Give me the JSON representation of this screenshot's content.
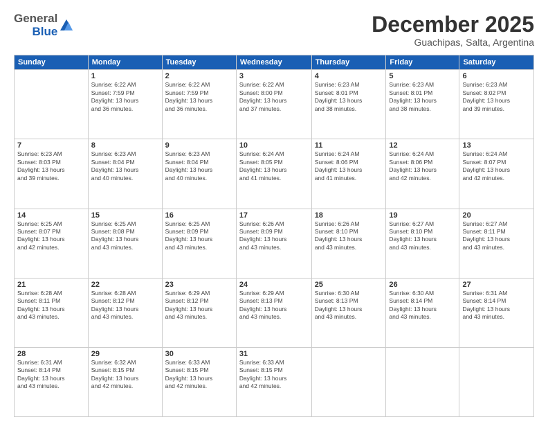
{
  "header": {
    "logo_general": "General",
    "logo_blue": "Blue",
    "month": "December 2025",
    "location": "Guachipas, Salta, Argentina"
  },
  "days_of_week": [
    "Sunday",
    "Monday",
    "Tuesday",
    "Wednesday",
    "Thursday",
    "Friday",
    "Saturday"
  ],
  "weeks": [
    [
      {
        "day": "",
        "info": ""
      },
      {
        "day": "1",
        "info": "Sunrise: 6:22 AM\nSunset: 7:59 PM\nDaylight: 13 hours\nand 36 minutes."
      },
      {
        "day": "2",
        "info": "Sunrise: 6:22 AM\nSunset: 7:59 PM\nDaylight: 13 hours\nand 36 minutes."
      },
      {
        "day": "3",
        "info": "Sunrise: 6:22 AM\nSunset: 8:00 PM\nDaylight: 13 hours\nand 37 minutes."
      },
      {
        "day": "4",
        "info": "Sunrise: 6:23 AM\nSunset: 8:01 PM\nDaylight: 13 hours\nand 38 minutes."
      },
      {
        "day": "5",
        "info": "Sunrise: 6:23 AM\nSunset: 8:01 PM\nDaylight: 13 hours\nand 38 minutes."
      },
      {
        "day": "6",
        "info": "Sunrise: 6:23 AM\nSunset: 8:02 PM\nDaylight: 13 hours\nand 39 minutes."
      }
    ],
    [
      {
        "day": "7",
        "info": "Sunrise: 6:23 AM\nSunset: 8:03 PM\nDaylight: 13 hours\nand 39 minutes."
      },
      {
        "day": "8",
        "info": "Sunrise: 6:23 AM\nSunset: 8:04 PM\nDaylight: 13 hours\nand 40 minutes."
      },
      {
        "day": "9",
        "info": "Sunrise: 6:23 AM\nSunset: 8:04 PM\nDaylight: 13 hours\nand 40 minutes."
      },
      {
        "day": "10",
        "info": "Sunrise: 6:24 AM\nSunset: 8:05 PM\nDaylight: 13 hours\nand 41 minutes."
      },
      {
        "day": "11",
        "info": "Sunrise: 6:24 AM\nSunset: 8:06 PM\nDaylight: 13 hours\nand 41 minutes."
      },
      {
        "day": "12",
        "info": "Sunrise: 6:24 AM\nSunset: 8:06 PM\nDaylight: 13 hours\nand 42 minutes."
      },
      {
        "day": "13",
        "info": "Sunrise: 6:24 AM\nSunset: 8:07 PM\nDaylight: 13 hours\nand 42 minutes."
      }
    ],
    [
      {
        "day": "14",
        "info": "Sunrise: 6:25 AM\nSunset: 8:07 PM\nDaylight: 13 hours\nand 42 minutes."
      },
      {
        "day": "15",
        "info": "Sunrise: 6:25 AM\nSunset: 8:08 PM\nDaylight: 13 hours\nand 43 minutes."
      },
      {
        "day": "16",
        "info": "Sunrise: 6:25 AM\nSunset: 8:09 PM\nDaylight: 13 hours\nand 43 minutes."
      },
      {
        "day": "17",
        "info": "Sunrise: 6:26 AM\nSunset: 8:09 PM\nDaylight: 13 hours\nand 43 minutes."
      },
      {
        "day": "18",
        "info": "Sunrise: 6:26 AM\nSunset: 8:10 PM\nDaylight: 13 hours\nand 43 minutes."
      },
      {
        "day": "19",
        "info": "Sunrise: 6:27 AM\nSunset: 8:10 PM\nDaylight: 13 hours\nand 43 minutes."
      },
      {
        "day": "20",
        "info": "Sunrise: 6:27 AM\nSunset: 8:11 PM\nDaylight: 13 hours\nand 43 minutes."
      }
    ],
    [
      {
        "day": "21",
        "info": "Sunrise: 6:28 AM\nSunset: 8:11 PM\nDaylight: 13 hours\nand 43 minutes."
      },
      {
        "day": "22",
        "info": "Sunrise: 6:28 AM\nSunset: 8:12 PM\nDaylight: 13 hours\nand 43 minutes."
      },
      {
        "day": "23",
        "info": "Sunrise: 6:29 AM\nSunset: 8:12 PM\nDaylight: 13 hours\nand 43 minutes."
      },
      {
        "day": "24",
        "info": "Sunrise: 6:29 AM\nSunset: 8:13 PM\nDaylight: 13 hours\nand 43 minutes."
      },
      {
        "day": "25",
        "info": "Sunrise: 6:30 AM\nSunset: 8:13 PM\nDaylight: 13 hours\nand 43 minutes."
      },
      {
        "day": "26",
        "info": "Sunrise: 6:30 AM\nSunset: 8:14 PM\nDaylight: 13 hours\nand 43 minutes."
      },
      {
        "day": "27",
        "info": "Sunrise: 6:31 AM\nSunset: 8:14 PM\nDaylight: 13 hours\nand 43 minutes."
      }
    ],
    [
      {
        "day": "28",
        "info": "Sunrise: 6:31 AM\nSunset: 8:14 PM\nDaylight: 13 hours\nand 43 minutes."
      },
      {
        "day": "29",
        "info": "Sunrise: 6:32 AM\nSunset: 8:15 PM\nDaylight: 13 hours\nand 42 minutes."
      },
      {
        "day": "30",
        "info": "Sunrise: 6:33 AM\nSunset: 8:15 PM\nDaylight: 13 hours\nand 42 minutes."
      },
      {
        "day": "31",
        "info": "Sunrise: 6:33 AM\nSunset: 8:15 PM\nDaylight: 13 hours\nand 42 minutes."
      },
      {
        "day": "",
        "info": ""
      },
      {
        "day": "",
        "info": ""
      },
      {
        "day": "",
        "info": ""
      }
    ]
  ]
}
